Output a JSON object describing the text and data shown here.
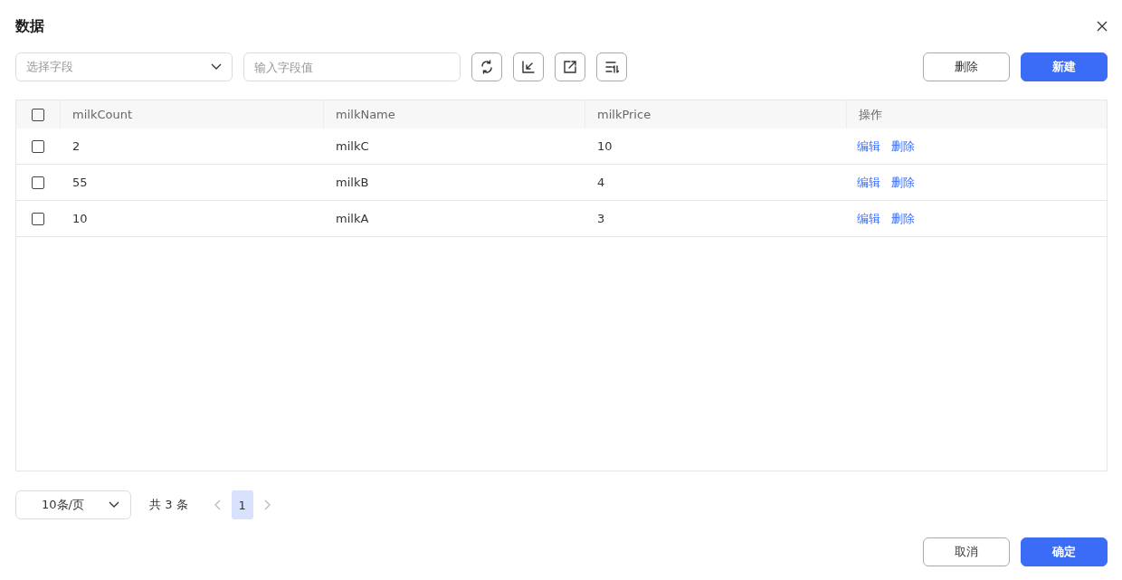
{
  "dialog": {
    "title": "数据"
  },
  "toolbar": {
    "field_select": {
      "placeholder": "选择字段"
    },
    "value_input": {
      "placeholder": "输入字段值"
    },
    "buttons": [
      {
        "label": "删除",
        "kind": "default"
      },
      {
        "label": "新建",
        "kind": "primary"
      }
    ]
  },
  "table": {
    "select_all": {
      "checked": false
    },
    "columns": [
      "milkCount",
      "milkName",
      "milkPrice",
      "操作"
    ],
    "rows": [
      {
        "checked": false,
        "cells": [
          "2",
          "milkC",
          "10"
        ],
        "actions": [
          "编辑",
          "删除"
        ]
      },
      {
        "checked": false,
        "cells": [
          "55",
          "milkB",
          "4"
        ],
        "actions": [
          "编辑",
          "删除"
        ]
      },
      {
        "checked": false,
        "cells": [
          "10",
          "milkA",
          "3"
        ],
        "actions": [
          "编辑",
          "删除"
        ]
      }
    ]
  },
  "pagination": {
    "page_size": "10条/页",
    "total": "共 3 条",
    "pages": [
      {
        "label": "1",
        "selected": true
      }
    ]
  },
  "footer": {
    "buttons": [
      {
        "label": "取消",
        "kind": "default"
      },
      {
        "label": "确定",
        "kind": "primary"
      }
    ]
  }
}
